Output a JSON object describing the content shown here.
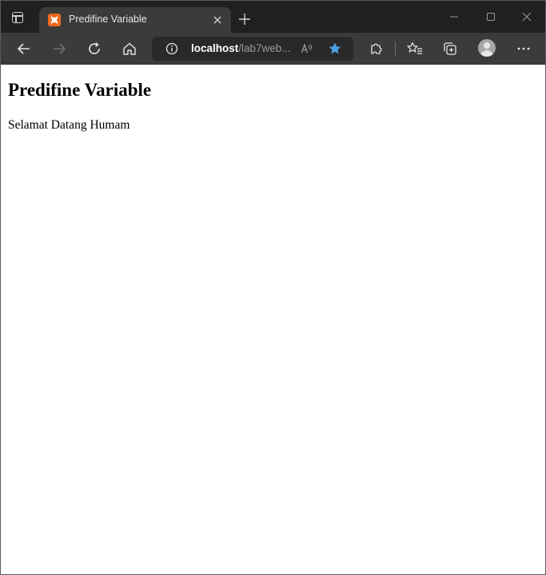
{
  "browser": {
    "tab": {
      "title": "Predifine Variable",
      "favicon_color": "#f06a1f"
    },
    "address": {
      "host": "localhost",
      "path": "/lab7web..."
    },
    "icons": [
      "tab-actions-icon",
      "close-icon",
      "plus-icon",
      "minimize-icon",
      "maximize-icon",
      "back-icon",
      "forward-icon",
      "refresh-icon",
      "home-icon",
      "info-icon",
      "read-aloud-icon",
      "star-icon",
      "extensions-icon",
      "favorites-icon",
      "collections-icon",
      "avatar",
      "more-icon"
    ],
    "accent_color": "#4a9fe0"
  },
  "page": {
    "heading": "Predifine Variable",
    "text": "Selamat Datang Humam"
  }
}
